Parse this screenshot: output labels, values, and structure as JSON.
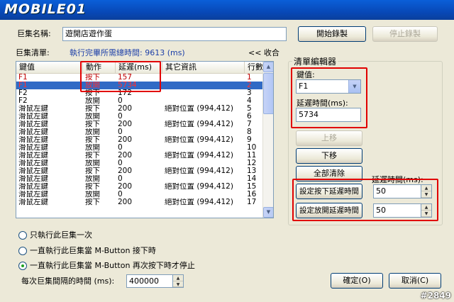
{
  "app": {
    "logo": "MOBILE01",
    "watermark": "#2849"
  },
  "macro": {
    "name_label": "巨集名稱:",
    "name_value": "遊開店遊作蛋",
    "list_label": "巨集清單:",
    "time_text": "執行完畢所需總時間: 9613 (ms)",
    "collapse_link": "<< 收合"
  },
  "buttons": {
    "start_record": "開始錄製",
    "stop_record": "停止錄製",
    "move_up": "上移",
    "move_down": "下移",
    "clear_all": "全部清除",
    "set_press_delay": "設定按下延遲時間",
    "set_release_delay": "設定放開延遲時間",
    "ok": "確定(O)",
    "cancel": "取消(C)"
  },
  "table": {
    "columns": [
      "鍵值",
      "動作",
      "延遲(ms)",
      "其它資訊",
      "行數"
    ],
    "rows": [
      [
        "F1",
        "按下",
        "157",
        "",
        "1"
      ],
      [
        "F1",
        "放開",
        "5734",
        "",
        "2"
      ],
      [
        "F2",
        "按下",
        "172",
        "",
        "3"
      ],
      [
        "F2",
        "放開",
        "0",
        "",
        "4"
      ],
      [
        "滑鼠左鍵",
        "按下",
        "200",
        "絕對位置 (994,412)",
        "5"
      ],
      [
        "滑鼠左鍵",
        "放開",
        "0",
        "",
        "6"
      ],
      [
        "滑鼠左鍵",
        "按下",
        "200",
        "絕對位置 (994,412)",
        "7"
      ],
      [
        "滑鼠左鍵",
        "放開",
        "0",
        "",
        "8"
      ],
      [
        "滑鼠左鍵",
        "按下",
        "200",
        "絕對位置 (994,412)",
        "9"
      ],
      [
        "滑鼠左鍵",
        "放開",
        "0",
        "",
        "10"
      ],
      [
        "滑鼠左鍵",
        "按下",
        "200",
        "絕對位置 (994,412)",
        "11"
      ],
      [
        "滑鼠左鍵",
        "放開",
        "0",
        "",
        "12"
      ],
      [
        "滑鼠左鍵",
        "按下",
        "200",
        "絕對位置 (994,412)",
        "13"
      ],
      [
        "滑鼠左鍵",
        "放開",
        "0",
        "",
        "14"
      ],
      [
        "滑鼠左鍵",
        "按下",
        "200",
        "絕對位置 (994,412)",
        "15"
      ],
      [
        "滑鼠左鍵",
        "放開",
        "0",
        "",
        "16"
      ],
      [
        "滑鼠左鍵",
        "按下",
        "200",
        "絕對位置 (994,412)",
        "17"
      ]
    ]
  },
  "editor": {
    "group_title": "清單編輯器",
    "key_label": "鍵值:",
    "key_value": "F1",
    "delay_label": "延遲時間(ms):",
    "delay_value": "5734",
    "delay_time_label": "延遲時間(ms):",
    "press_delay_value": "50",
    "release_delay_value": "50"
  },
  "options": {
    "radio1": "只執行此巨集一次",
    "radio2": "一直執行此巨集當 M-Button 接下時",
    "radio3": "一直執行此巨集當 M-Button 再次按下時才停止",
    "interval_label": "每次巨集間隔的時間 (ms):",
    "interval_value": "400000"
  },
  "icons": {
    "arrow_up": "▲",
    "arrow_down": "▼",
    "combo_down": "▼"
  }
}
